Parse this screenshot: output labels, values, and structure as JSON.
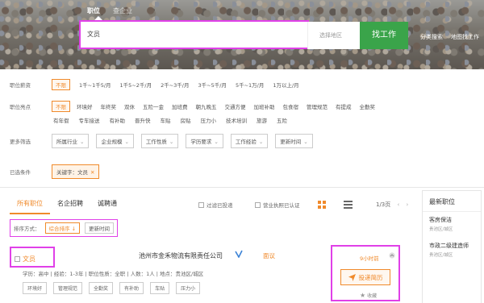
{
  "hero": {
    "tabs": [
      "职位",
      "查企业"
    ],
    "search_value": "文员",
    "region_placeholder": "选择地区",
    "find_button": "找工作",
    "links": [
      "分类搜索",
      "地图找工作"
    ]
  },
  "filters": {
    "salary": {
      "label": "职位薪资",
      "items": [
        "不限",
        "1千~1千5/月",
        "1千5~2千/月",
        "2千~3千/月",
        "3千~5千/月",
        "5千~1万/月",
        "1万以上/月"
      ]
    },
    "highlights": {
      "label": "职位亮点",
      "row1": [
        "不限",
        "环境好",
        "年终奖",
        "双休",
        "五险一金",
        "加班费",
        "朝九晚五",
        "交通方便",
        "加班补助",
        "包食宿",
        "管理规范",
        "有提成",
        "全勤奖"
      ],
      "row2": [
        "有年假",
        "专车接送",
        "有补助",
        "晋升快",
        "车贴",
        "房贴",
        "压力小",
        "技术培训",
        "旅游",
        "五险"
      ]
    },
    "more": {
      "label": "更多筛选",
      "dropdowns": [
        "所属行业",
        "企业规模",
        "工作性质",
        "学历要求",
        "工作经验",
        "更新时间"
      ]
    },
    "selected": {
      "label": "已选条件",
      "chip": "关键字：文员"
    }
  },
  "list": {
    "tabs": [
      "所有职位",
      "名企招聘",
      "诚聘通"
    ],
    "opt1": "过滤已投递",
    "opt2": "营业执照已认证",
    "pager": "1/3页",
    "sort_label": "排序方式：",
    "sort_active": "综合排序",
    "sort_other": "更新时间"
  },
  "job": {
    "title": "文员",
    "company": "池州市金禾物流有限责任公司",
    "salary": "面议",
    "meta": "学历：高中 | 经验：1-3年 | 职位性质：全职 | 人数：1人 | 地点：贵池区/城区",
    "tags": [
      "环境好",
      "管理规范",
      "全勤奖",
      "有补助",
      "车贴",
      "压力小"
    ],
    "time": "9小时前",
    "apply": "投递简历",
    "fav": "收藏"
  },
  "sidebar": {
    "title": "最新职位",
    "items": [
      {
        "title": "客房保洁",
        "sub": "贵池区/城区"
      },
      {
        "title": "市政二级建造师",
        "sub": "贵池区/城区"
      }
    ]
  },
  "colors": {
    "accent": "#f08a2b",
    "green": "#3aa44a",
    "highlight": "#e040e8"
  }
}
